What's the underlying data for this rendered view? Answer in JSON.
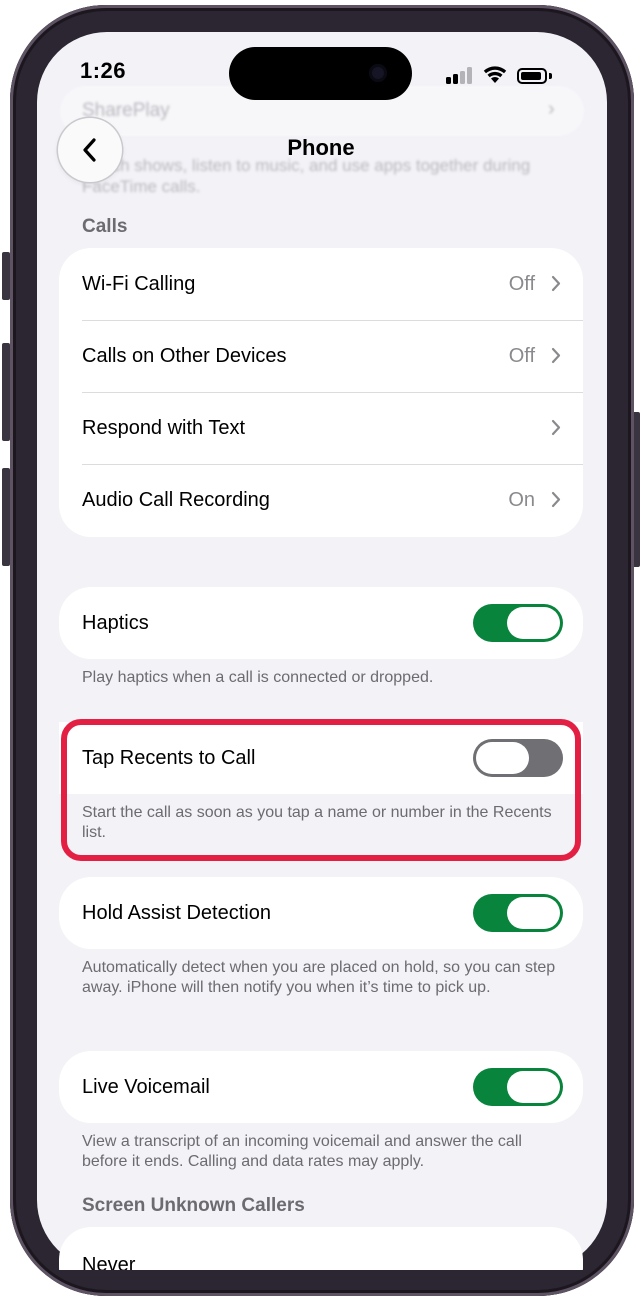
{
  "status_bar": {
    "time": "1:26",
    "signal_icon": "cellular-signal-icon",
    "wifi_icon": "wifi-icon",
    "battery_icon": "battery-icon"
  },
  "background_blurred": {
    "top_item": "SharePlay",
    "description": "Watch shows, listen to music, and use apps together during FaceTime calls."
  },
  "nav": {
    "back_icon": "chevron-left-icon",
    "title": "Phone"
  },
  "calls_section": {
    "header": "Calls",
    "rows": [
      {
        "label": "Wi-Fi Calling",
        "value": "Off"
      },
      {
        "label": "Calls on Other Devices",
        "value": "Off"
      },
      {
        "label": "Respond with Text",
        "value": ""
      },
      {
        "label": "Audio Call Recording",
        "value": "On"
      }
    ]
  },
  "haptics": {
    "label": "Haptics",
    "enabled": true,
    "footnote": "Play haptics when a call is connected or dropped."
  },
  "tap_recents": {
    "label": "Tap Recents to Call",
    "enabled": false,
    "footnote": "Start the call as soon as you tap a name or number in the Recents list."
  },
  "hold_assist": {
    "label": "Hold Assist Detection",
    "enabled": true,
    "footnote": "Automatically detect when you are placed on hold, so you can step away. iPhone will then notify you when it’s time to pick up."
  },
  "live_voicemail": {
    "label": "Live Voicemail",
    "enabled": true,
    "footnote": "View a transcript of an incoming voicemail and answer the call before it ends. Calling and data rates may apply."
  },
  "screen_unknown": {
    "header": "Screen Unknown Callers",
    "first_option": "Never"
  },
  "colors": {
    "toggle_on": "#09843c",
    "toggle_off": "#6f6f74",
    "highlight": "#e32044",
    "background": "#f2f2f7"
  }
}
